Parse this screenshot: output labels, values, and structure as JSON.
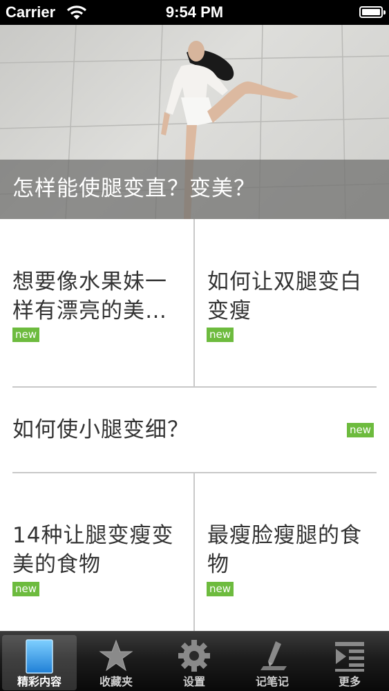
{
  "status_bar": {
    "carrier": "Carrier",
    "time": "9:54 PM"
  },
  "hero": {
    "title": "怎样能使腿变直？变美？"
  },
  "articles": [
    {
      "title_line1": "想要像水果妹一",
      "title_line2": "样有漂亮的美…",
      "badge": "new"
    },
    {
      "title_line1": "如何让双腿变白",
      "title_line2": "变瘦",
      "badge": "new"
    },
    {
      "title_line1": "如何使小腿变细？",
      "badge": "new"
    },
    {
      "title_line1": "14种让腿变瘦变",
      "title_line2": "美的食物",
      "badge": "new"
    },
    {
      "title_line1": "最瘦脸瘦腿的食",
      "title_line2": "物",
      "badge": "new"
    }
  ],
  "tabs": [
    {
      "label": "精彩内容",
      "icon": "document-icon",
      "active": true
    },
    {
      "label": "收藏夹",
      "icon": "star-icon"
    },
    {
      "label": "设置",
      "icon": "gear-icon"
    },
    {
      "label": "记笔记",
      "icon": "pencil-icon"
    },
    {
      "label": "更多",
      "icon": "more-list-icon"
    }
  ],
  "colors": {
    "badge": "#6dbb3e",
    "tabbar": "#1c1c1c",
    "divider": "#c8c8c8"
  }
}
